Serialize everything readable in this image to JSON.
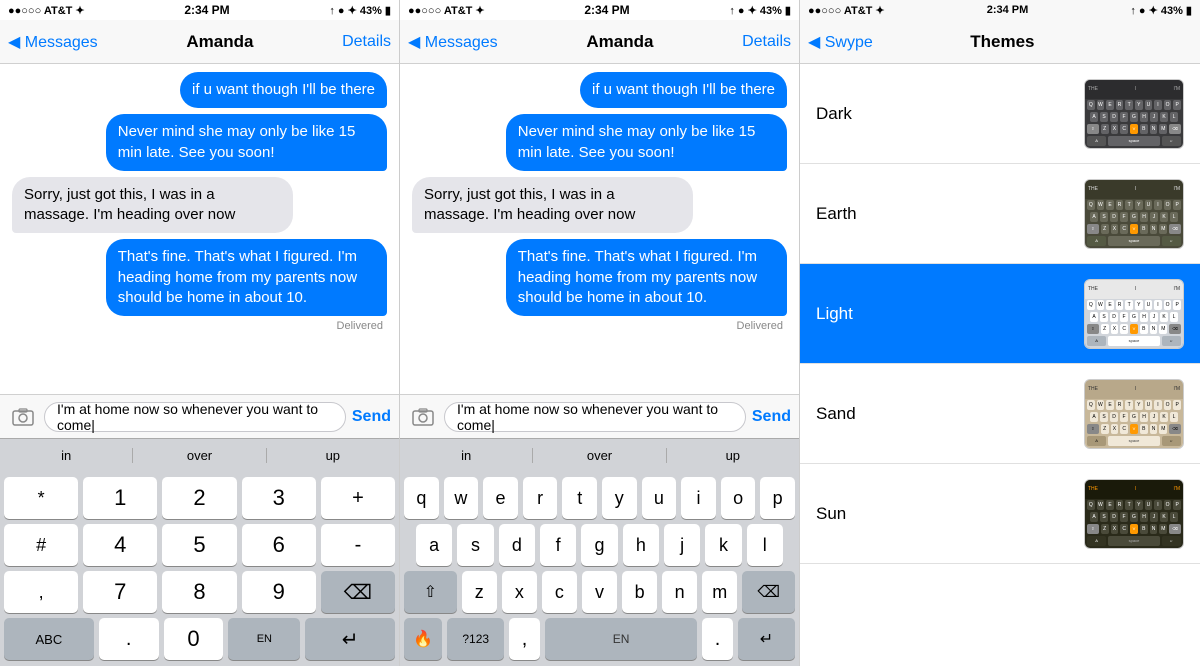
{
  "panels": [
    {
      "id": "panel1",
      "status_bar": {
        "left": "●●○○○ AT&T ✦",
        "time": "2:34 PM",
        "right": "↑ ● ✦ 43%"
      },
      "nav": {
        "back_label": "◀ Messages",
        "title": "Amanda",
        "detail": "Details"
      },
      "messages": [
        {
          "type": "outgoing",
          "text": "if u want though I'll be there"
        },
        {
          "type": "outgoing",
          "text": "Never mind she may only be like 15 min late. See you soon!"
        },
        {
          "type": "incoming",
          "text": "Sorry, just got this, I was in a massage. I'm heading over now"
        },
        {
          "type": "outgoing",
          "text": "That's fine. That's what I figured. I'm heading home from my parents now should be home in about 10."
        }
      ],
      "delivered": "Delivered",
      "input_text": "I'm at home now so whenever you want to come",
      "send_label": "Send",
      "suggestions": [
        "in",
        "over",
        "up"
      ],
      "keyboard_type": "number",
      "num_rows": [
        [
          "*",
          "1",
          "2",
          "3",
          "+"
        ],
        [
          "#",
          "4",
          "5",
          "6",
          "-"
        ],
        [
          ",",
          "7",
          "8",
          "9",
          "⌫"
        ]
      ],
      "bottom_row": [
        "ABC",
        ".",
        "0",
        "EN",
        "↵"
      ]
    },
    {
      "id": "panel2",
      "status_bar": {
        "left": "●●○○○ AT&T ✦",
        "time": "2:34 PM",
        "right": "↑ ● ✦ 43%"
      },
      "nav": {
        "back_label": "◀ Messages",
        "title": "Amanda",
        "detail": "Details"
      },
      "messages": [
        {
          "type": "outgoing",
          "text": "if u want though I'll be there"
        },
        {
          "type": "outgoing",
          "text": "Never mind she may only be like 15 min late. See you soon!"
        },
        {
          "type": "incoming",
          "text": "Sorry, just got this, I was in a massage. I'm heading over now"
        },
        {
          "type": "outgoing",
          "text": "That's fine. That's what I figured. I'm heading home from my parents now should be home in about 10."
        }
      ],
      "delivered": "Delivered",
      "input_text": "I'm at home now so whenever you want to come",
      "send_label": "Send",
      "suggestions": [
        "in",
        "over",
        "up"
      ],
      "keyboard_type": "qwerty",
      "qwerty_rows": [
        [
          "q",
          "w",
          "e",
          "r",
          "t",
          "y",
          "u",
          "i",
          "o",
          "p"
        ],
        [
          "a",
          "s",
          "d",
          "f",
          "g",
          "h",
          "j",
          "k",
          "l"
        ],
        [
          "⇧",
          "z",
          "x",
          "c",
          "v",
          "b",
          "n",
          "m",
          "⌫"
        ]
      ],
      "bottom_row": [
        "🔥",
        "?123",
        ",",
        "EN",
        ".",
        "↵"
      ]
    }
  ],
  "themes_panel": {
    "status_bar": {
      "left": "●●○○○ AT&T ✦",
      "time": "2:34 PM",
      "right": "↑ ● ✦ 43%"
    },
    "nav": {
      "back_label": "◀ Swype",
      "title": "Themes"
    },
    "themes": [
      {
        "id": "dark",
        "name": "Dark",
        "selected": false,
        "preview_class": "dark-kb"
      },
      {
        "id": "earth",
        "name": "Earth",
        "selected": false,
        "preview_class": "earth-kb"
      },
      {
        "id": "light",
        "name": "Light",
        "selected": true,
        "preview_class": "light-kb"
      },
      {
        "id": "sand",
        "name": "Sand",
        "selected": false,
        "preview_class": "sand-kb"
      },
      {
        "id": "sun",
        "name": "Sun",
        "selected": false,
        "preview_class": "sun-kb"
      }
    ]
  }
}
